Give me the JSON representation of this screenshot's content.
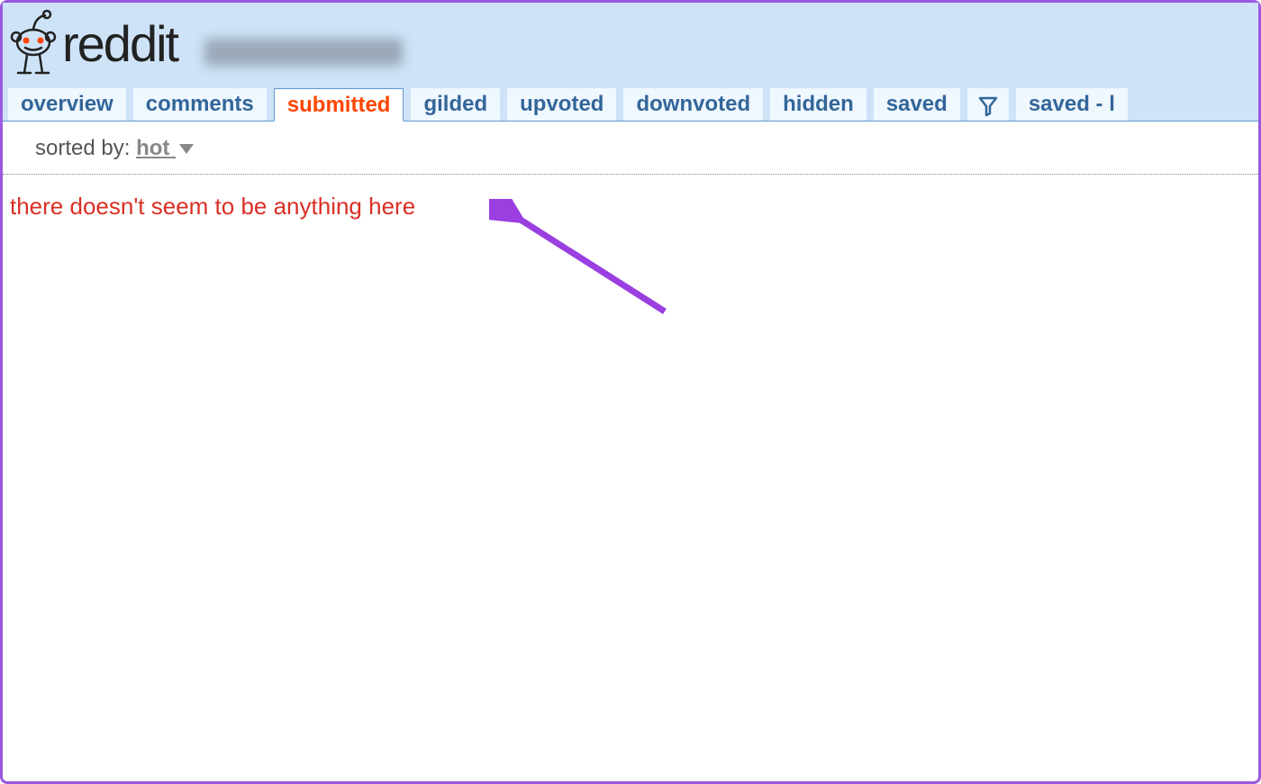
{
  "header": {
    "site_name": "reddit"
  },
  "tabs": [
    {
      "label": "overview",
      "active": false
    },
    {
      "label": "comments",
      "active": false
    },
    {
      "label": "submitted",
      "active": true
    },
    {
      "label": "gilded",
      "active": false
    },
    {
      "label": "upvoted",
      "active": false
    },
    {
      "label": "downvoted",
      "active": false
    },
    {
      "label": "hidden",
      "active": false
    },
    {
      "label": "saved",
      "active": false
    },
    {
      "label": "saved - l",
      "active": false
    }
  ],
  "sort": {
    "label": "sorted by: ",
    "value": "hot"
  },
  "empty_message": "there doesn't seem to be anything here"
}
